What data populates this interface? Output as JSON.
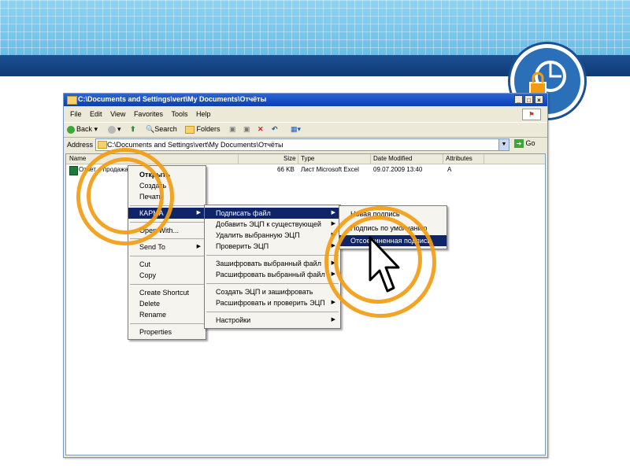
{
  "window": {
    "title": "C:\\Documents and Settings\\vert\\My Documents\\Отчёты",
    "controls": [
      "_",
      "□",
      "×"
    ]
  },
  "menubar": [
    "File",
    "Edit",
    "View",
    "Favorites",
    "Tools",
    "Help"
  ],
  "toolbar": {
    "back": "Back",
    "search": "Search",
    "folders": "Folders"
  },
  "address": {
    "label": "Address",
    "value": "C:\\Documents and Settings\\vert\\My Documents\\Отчёты",
    "go": "Go"
  },
  "list": {
    "columns": [
      "Name",
      "Size",
      "Type",
      "Date Modified",
      "Attributes"
    ],
    "rows": [
      {
        "name": "Отчет о продажах",
        "size": "66 KB",
        "type": "Лист Microsoft Excel",
        "date": "09.07.2009 13:40",
        "attr": "A"
      }
    ]
  },
  "context_menu": {
    "items": [
      "Открыть",
      "Создать",
      "Печать",
      "КАРМА",
      "Open With...",
      "Send To",
      "Cut",
      "Copy",
      "Create Shortcut",
      "Delete",
      "Rename",
      "Properties"
    ]
  },
  "karma_menu": {
    "items": [
      "Подписать файл",
      "Добавить ЭЦП к существующей",
      "Удалить выбранную ЭЦП",
      "Проверить ЭЦП",
      "Зашифровать выбранный файл",
      "Расшифровать выбранный файл",
      "Создать ЭЦП и зашифровать",
      "Расшифровать и проверить ЭЦП",
      "Настройки"
    ]
  },
  "sign_menu": {
    "items": [
      "Новая подпись",
      "Подпись по умолчанию",
      "Отсоединенная подпись"
    ]
  },
  "colors": {
    "accent_ring": "#f39c12",
    "highlight": "#10246a",
    "title_bar": "#0a3fb0"
  }
}
